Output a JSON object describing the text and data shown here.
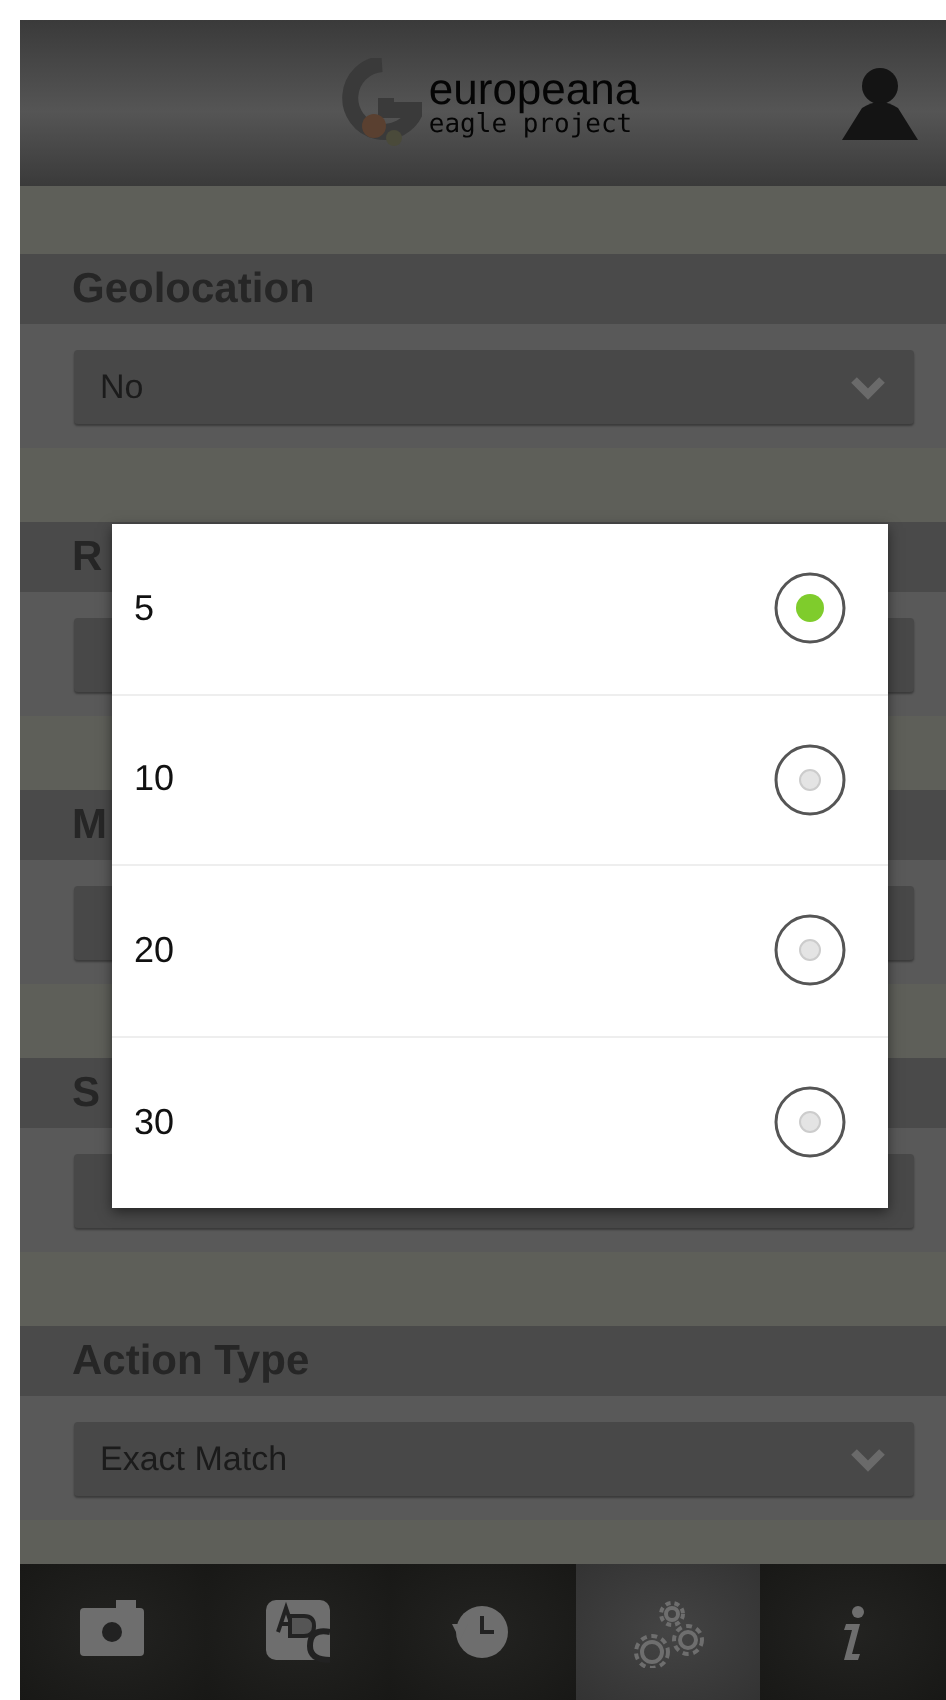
{
  "header": {
    "logo_title": "europeana",
    "logo_subtitle": "eagle project"
  },
  "settings": [
    {
      "label": "Geolocation",
      "value": "No"
    },
    {
      "label": "R"
    },
    {
      "label": "M"
    },
    {
      "label": "S"
    },
    {
      "label": "Action Type",
      "value": "Exact Match"
    }
  ],
  "dialog": {
    "options": [
      {
        "label": "5",
        "selected": true
      },
      {
        "label": "10",
        "selected": false
      },
      {
        "label": "20",
        "selected": false
      },
      {
        "label": "30",
        "selected": false
      }
    ]
  },
  "nav_tabs": [
    {
      "kind": "camera",
      "selected": false
    },
    {
      "kind": "text",
      "selected": false
    },
    {
      "kind": "history",
      "selected": false
    },
    {
      "kind": "settings",
      "selected": true
    },
    {
      "kind": "info",
      "selected": false
    }
  ]
}
